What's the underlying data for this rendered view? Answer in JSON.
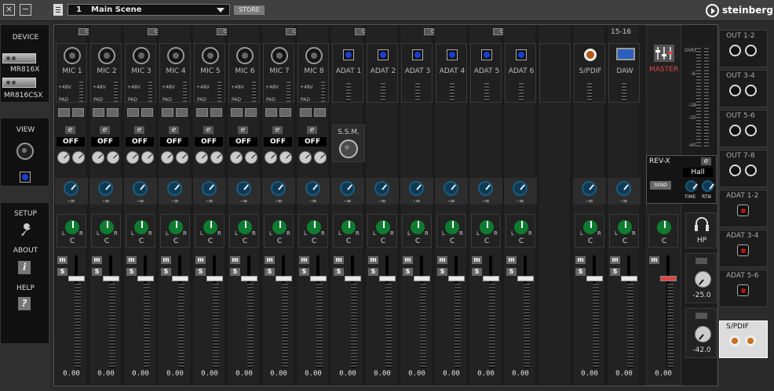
{
  "scene": {
    "number": "1",
    "name": "Main Scene",
    "store_label": "STORE"
  },
  "brand": {
    "name": "steinberg"
  },
  "nav": {
    "device_label": "DEVICE",
    "device_1": "MR816X",
    "device_2": "MR816CSX",
    "view_label": "VIEW",
    "setup_label": "SETUP",
    "about_label": "ABOUT",
    "help_label": "HELP"
  },
  "channels": [
    {
      "name": "MIC 1",
      "kind": "mic",
      "eq": "OFF",
      "send": "-∞",
      "pan": "C",
      "fader": "0.00",
      "phantom": "+48V",
      "pad": "PAD"
    },
    {
      "name": "MIC 2",
      "kind": "mic",
      "eq": "OFF",
      "send": "-∞",
      "pan": "C",
      "fader": "0.00",
      "phantom": "+48V",
      "pad": "PAD"
    },
    {
      "name": "MIC 3",
      "kind": "mic",
      "eq": "OFF",
      "send": "-∞",
      "pan": "C",
      "fader": "0.00",
      "phantom": "+48V",
      "pad": "PAD"
    },
    {
      "name": "MIC 4",
      "kind": "mic",
      "eq": "OFF",
      "send": "-∞",
      "pan": "C",
      "fader": "0.00",
      "phantom": "+48V",
      "pad": "PAD"
    },
    {
      "name": "MIC 5",
      "kind": "mic",
      "eq": "OFF",
      "send": "-∞",
      "pan": "C",
      "fader": "0.00",
      "phantom": "+48V",
      "pad": "PAD"
    },
    {
      "name": "MIC 6",
      "kind": "mic",
      "eq": "OFF",
      "send": "-∞",
      "pan": "C",
      "fader": "0.00",
      "phantom": "+48V",
      "pad": "PAD"
    },
    {
      "name": "MIC 7",
      "kind": "mic",
      "eq": "OFF",
      "send": "-∞",
      "pan": "C",
      "fader": "0.00",
      "phantom": "+48V",
      "pad": "PAD"
    },
    {
      "name": "MIC 8",
      "kind": "mic",
      "eq": "OFF",
      "send": "-∞",
      "pan": "C",
      "fader": "0.00",
      "phantom": "+48V",
      "pad": "PAD"
    },
    {
      "name": "ADAT 1",
      "kind": "adat",
      "eq": "",
      "send": "-∞",
      "pan": "C",
      "fader": "0.00",
      "phantom": "",
      "pad": ""
    },
    {
      "name": "ADAT 2",
      "kind": "adat",
      "eq": "",
      "send": "-∞",
      "pan": "C",
      "fader": "0.00",
      "phantom": "",
      "pad": ""
    },
    {
      "name": "ADAT 3",
      "kind": "adat",
      "eq": "",
      "send": "-∞",
      "pan": "C",
      "fader": "0.00",
      "phantom": "",
      "pad": ""
    },
    {
      "name": "ADAT 4",
      "kind": "adat",
      "eq": "",
      "send": "-∞",
      "pan": "C",
      "fader": "0.00",
      "phantom": "",
      "pad": ""
    },
    {
      "name": "ADAT 5",
      "kind": "adat",
      "eq": "",
      "send": "-∞",
      "pan": "C",
      "fader": "0.00",
      "phantom": "",
      "pad": ""
    },
    {
      "name": "ADAT 6",
      "kind": "adat",
      "eq": "",
      "send": "-∞",
      "pan": "C",
      "fader": "0.00",
      "phantom": "",
      "pad": ""
    },
    {
      "name": "",
      "kind": "blank",
      "eq": "",
      "send": "",
      "pan": "",
      "fader": "",
      "phantom": "",
      "pad": ""
    },
    {
      "name": "S/PDIF",
      "kind": "spdif",
      "eq": "",
      "send": "-∞",
      "pan": "C",
      "fader": "0.00",
      "phantom": "",
      "pad": ""
    },
    {
      "name": "DAW",
      "kind": "daw",
      "eq": "",
      "send": "-∞",
      "pan": "C",
      "fader": "0.00",
      "phantom": "",
      "pad": "",
      "top": "15-16"
    }
  ],
  "ssm_label": "S.S.M.",
  "master": {
    "label": "MASTER",
    "pan": "C",
    "fader": "0.00",
    "meter_labels": [
      "OVER",
      "-6",
      "-18",
      "-30",
      "-60"
    ]
  },
  "reverb": {
    "title": "REV-X",
    "type": "Hall",
    "send_label": "SEND",
    "time_label": "TIME",
    "rtn_label": "RTN"
  },
  "phones": {
    "hp_label": "HP",
    "hp1_value": "-25.0",
    "hp2_value": "-42.0"
  },
  "outputs": [
    {
      "label": "OUT 1-2",
      "kind": "analog"
    },
    {
      "label": "OUT 3-4",
      "kind": "analog"
    },
    {
      "label": "OUT 5-6",
      "kind": "analog"
    },
    {
      "label": "OUT 7-8",
      "kind": "analog"
    },
    {
      "label": "ADAT 1-2",
      "kind": "adat"
    },
    {
      "label": "ADAT 3-4",
      "kind": "adat"
    },
    {
      "label": "ADAT 5-6",
      "kind": "adat"
    },
    {
      "label": "S/PDIF",
      "kind": "spdif",
      "selected": true
    }
  ],
  "hp_tiny_label": "1☠2⚠",
  "colors": {
    "accent_red": "#e04646",
    "adat_blue": "#1b3fd3",
    "pan_green": "#0f7b31",
    "send_blue": "#0d3a55"
  }
}
